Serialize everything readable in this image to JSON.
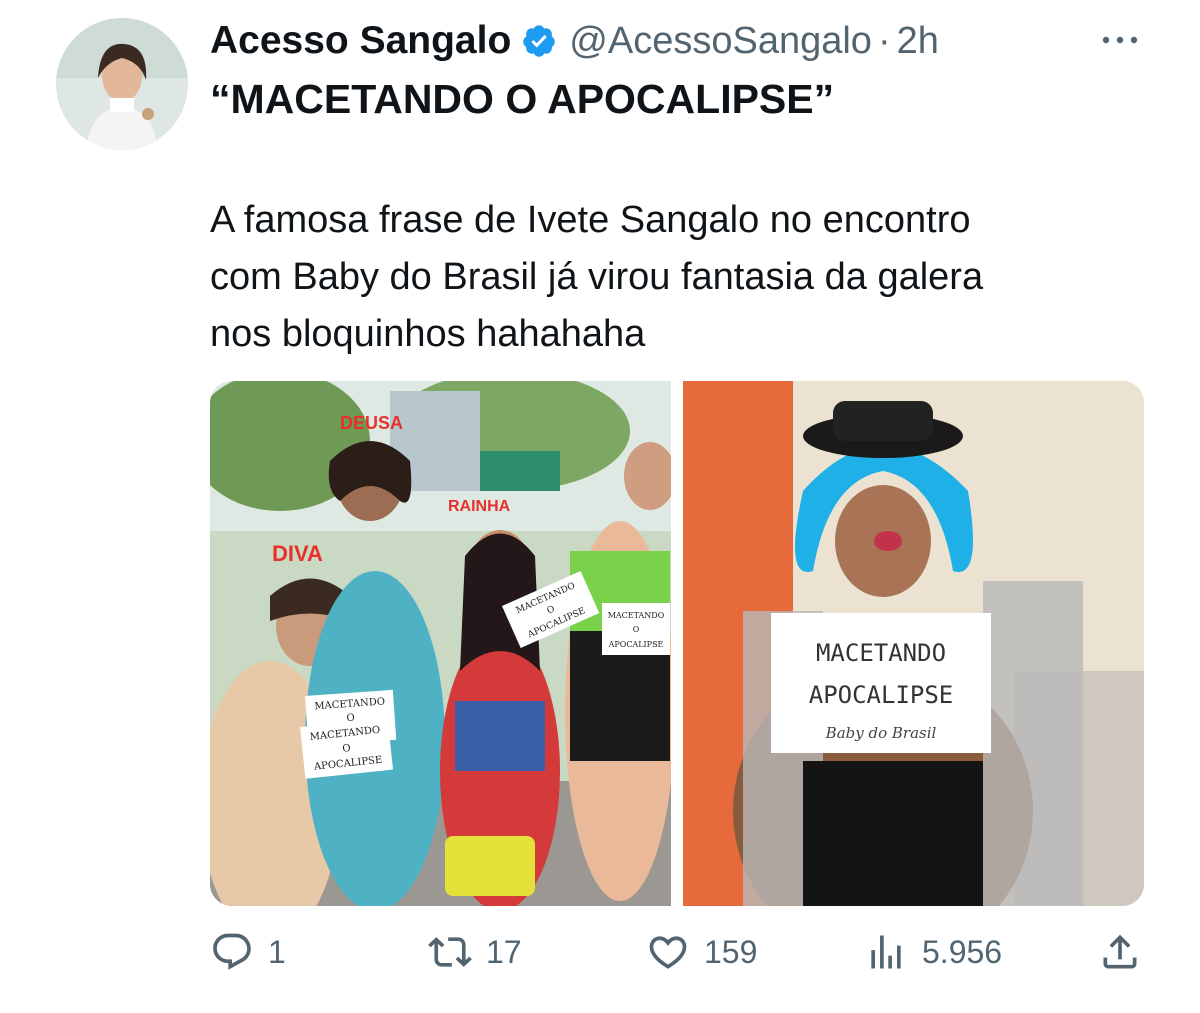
{
  "tweet": {
    "author_name": "Acesso Sangalo",
    "handle": "@AcessoSangalo",
    "separator": "·",
    "time": "2h",
    "headline": "“MACETANDO O APOCALIPSE”",
    "body": "A famosa frase de Ivete Sangalo no encontro\ncom Baby do Brasil já virou fantasia da galera\nnos bloquinhos hahahaha",
    "verified": true
  },
  "media": {
    "photo_1": {
      "crown_text_left": "DIVA",
      "crown_text_center": "DEUSA",
      "crown_text_right": "RAINHA",
      "sign_line_1": "MACETANDO",
      "sign_line_2": "O",
      "sign_line_3": "APOCALIPSE"
    },
    "photo_2": {
      "sign_line_1": "MACETANDO",
      "sign_line_2": "APOCALIPSE",
      "sign_credit": "Baby do Brasil"
    }
  },
  "actions": {
    "replies": "1",
    "reposts": "17",
    "likes": "159",
    "views": "5.956"
  },
  "colors": {
    "text": "#0f1419",
    "muted": "#536471",
    "verified": "#1d9bf0"
  },
  "icons": [
    "more-icon",
    "verified-icon",
    "reply-icon",
    "repost-icon",
    "like-icon",
    "views-icon",
    "share-icon"
  ]
}
